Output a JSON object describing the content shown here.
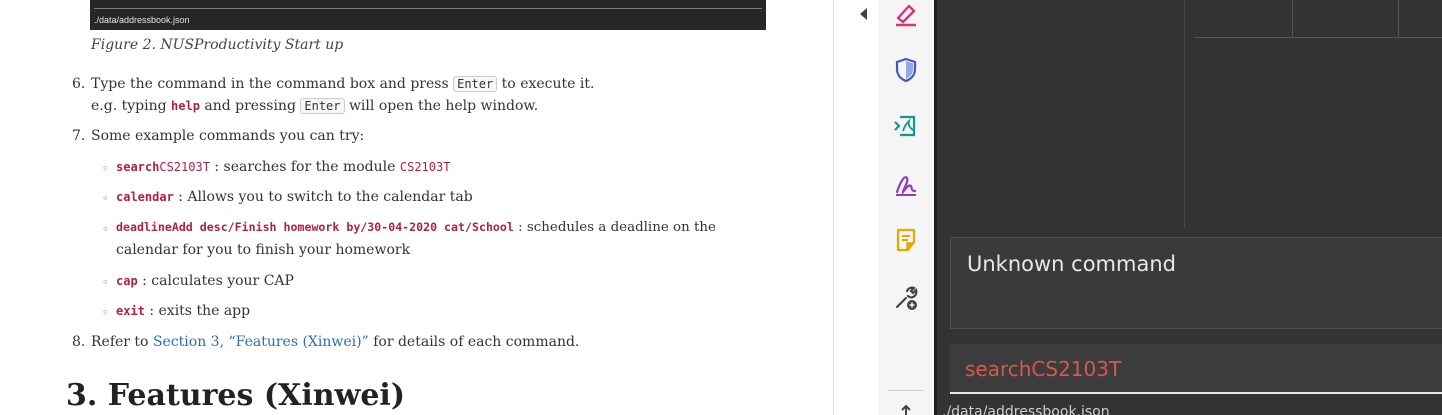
{
  "doc": {
    "screenshot_path": "./data/addressbook.json",
    "caption": "Figure 2. NUSProductivity Start up",
    "step6": {
      "num": "6.",
      "pre": "Type the command in the command box and press ",
      "key": "Enter",
      "post": " to execute it.",
      "line2_pre": "e.g. typing ",
      "line2_code": "help",
      "line2_mid": " and pressing ",
      "line2_key": "Enter",
      "line2_post": " will open the help window."
    },
    "step7": {
      "num": "7.",
      "text": "Some example commands you can try:",
      "items": [
        {
          "cmd": "search",
          "arg": "CS2103T",
          "text": " : searches for the module ",
          "code2": "CS2103T"
        },
        {
          "cmd": "calendar",
          "text": " : Allows you to switch to the calendar tab"
        },
        {
          "cmd": "deadlineAdd desc/Finish homework by/30-04-2020 cat/School",
          "text": " : schedules a deadline on the",
          "cont": "calendar for you to finish your homework"
        },
        {
          "cmd": "cap",
          "text": " : calculates your CAP"
        },
        {
          "cmd": "exit",
          "text": " : exits the app"
        }
      ]
    },
    "step8": {
      "num": "8.",
      "pre": "Refer to ",
      "link": "Section 3, “Features (Xinwei)”",
      "post": " for details of each command."
    },
    "heading": "3. Features (Xinwei)"
  },
  "rail": {
    "tools": [
      {
        "icon": "highlighter-icon",
        "color": "#e0307a"
      },
      {
        "icon": "shield-icon",
        "color": "#3d57d6"
      },
      {
        "icon": "pdf-export-icon",
        "color": "#13998b"
      },
      {
        "icon": "signature-pen-icon",
        "color": "#8c3fc2"
      },
      {
        "icon": "sticky-note-icon",
        "color": "#e5a800"
      },
      {
        "icon": "wrench-add-icon",
        "color": "#444444"
      }
    ]
  },
  "app": {
    "result_text": "Unknown command",
    "command_value": "searchCS2103T",
    "status_text": "./data/addressbook.json"
  }
}
